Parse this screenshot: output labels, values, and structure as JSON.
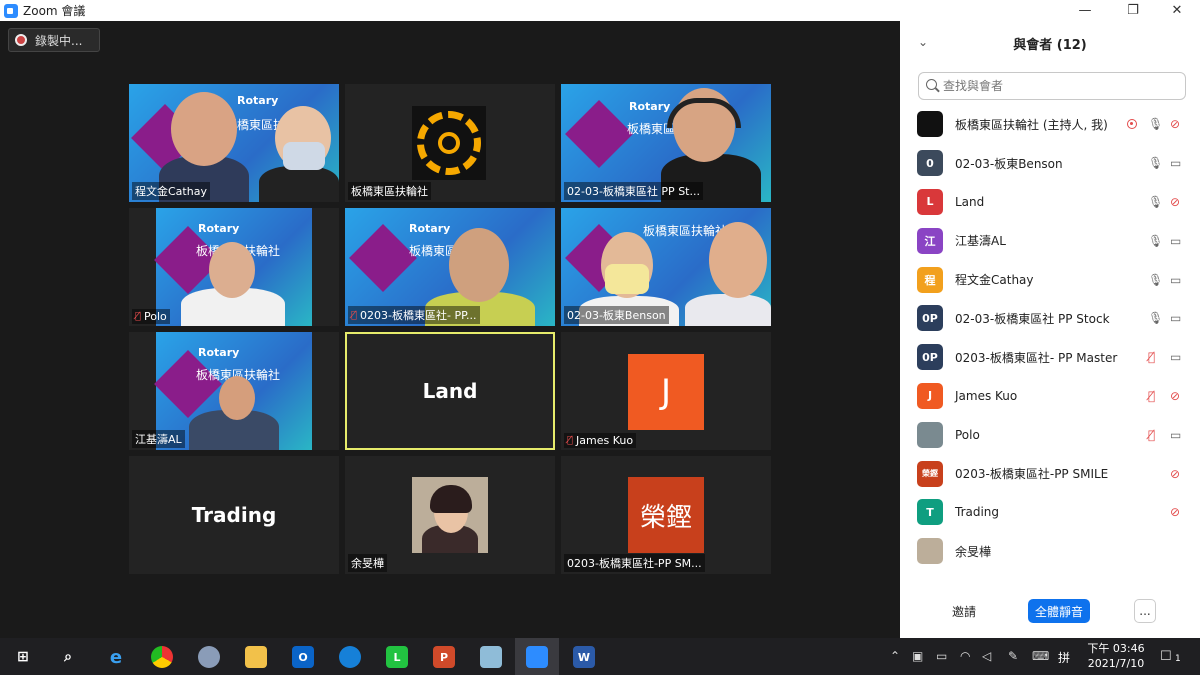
{
  "window": {
    "title": "Zoom 會議",
    "minimize": "—",
    "restore": "❐",
    "close": "✕"
  },
  "recording": {
    "label": "錄製中..."
  },
  "tiles": [
    {
      "name": "程文金Cathay",
      "muted": false
    },
    {
      "name": "板橋東區扶輪社",
      "muted": false
    },
    {
      "name": "02-03-板橋東區社 PP St...",
      "muted": false
    },
    {
      "name": "Polo",
      "muted": true
    },
    {
      "name": "0203-板橋東區社- PP...",
      "muted": true
    },
    {
      "name": "02-03-板東Benson",
      "muted": false
    },
    {
      "name": "江基濤AL",
      "muted": false
    },
    {
      "name": "Land",
      "big": "Land",
      "active": true
    },
    {
      "name": "James Kuo",
      "muted": true,
      "avatar": "J"
    },
    {
      "name": "Trading",
      "big": "Trading"
    },
    {
      "name": "余旻樺",
      "muted": false
    },
    {
      "name": "0203-板橋東區社-PP SM...",
      "avatar": "榮鏗"
    }
  ],
  "backdrop": {
    "org": "Rotary",
    "club": "板橋東區扶輪社"
  },
  "sidebar": {
    "title": "與會者 (12)",
    "search_placeholder": "查找與會者",
    "participants": [
      {
        "initial": "",
        "name": "板橋東區扶輪社 (主持人, 我)",
        "color": "#111111",
        "mic": "on",
        "cam": "off",
        "host": true
      },
      {
        "initial": "0",
        "name": "02-03-板東Benson",
        "color": "#3c4a5c",
        "mic": "on",
        "cam": "on"
      },
      {
        "initial": "L",
        "name": "Land",
        "color": "#d9383a",
        "mic": "on",
        "cam": "off"
      },
      {
        "initial": "江",
        "name": "江基濤AL",
        "color": "#8a44c4",
        "mic": "on",
        "cam": "on"
      },
      {
        "initial": "程",
        "name": "程文金Cathay",
        "color": "#f2a01d",
        "mic": "on",
        "cam": "on"
      },
      {
        "initial": "0P",
        "name": "02-03-板橋東區社 PP Stock",
        "color": "#2c3e5c",
        "mic": "on",
        "cam": "on"
      },
      {
        "initial": "0P",
        "name": "0203-板橋東區社- PP Master",
        "color": "#2c3e5c",
        "mic": "off",
        "cam": "on"
      },
      {
        "initial": "J",
        "name": "James Kuo",
        "color": "#f05a22",
        "mic": "off",
        "cam": "off"
      },
      {
        "initial": "",
        "name": "Polo",
        "color": "#7a8a90",
        "mic": "off",
        "cam": "on"
      },
      {
        "initial": "榮鏗",
        "name": "0203-板橋東區社-PP SMILE",
        "color": "#c8401c",
        "mic": "none",
        "cam": "off"
      },
      {
        "initial": "T",
        "name": "Trading",
        "color": "#0f9e80",
        "mic": "none",
        "cam": "off"
      },
      {
        "initial": "",
        "name": "余旻樺",
        "color": "#bcae9a",
        "mic": "none",
        "cam": "none"
      }
    ],
    "invite": "邀請",
    "mute_all": "全體靜音",
    "more": "..."
  },
  "taskbar": {
    "clock_time": "下午 03:46",
    "clock_date": "2021/7/10",
    "ime": "拼",
    "notifications": "1"
  }
}
